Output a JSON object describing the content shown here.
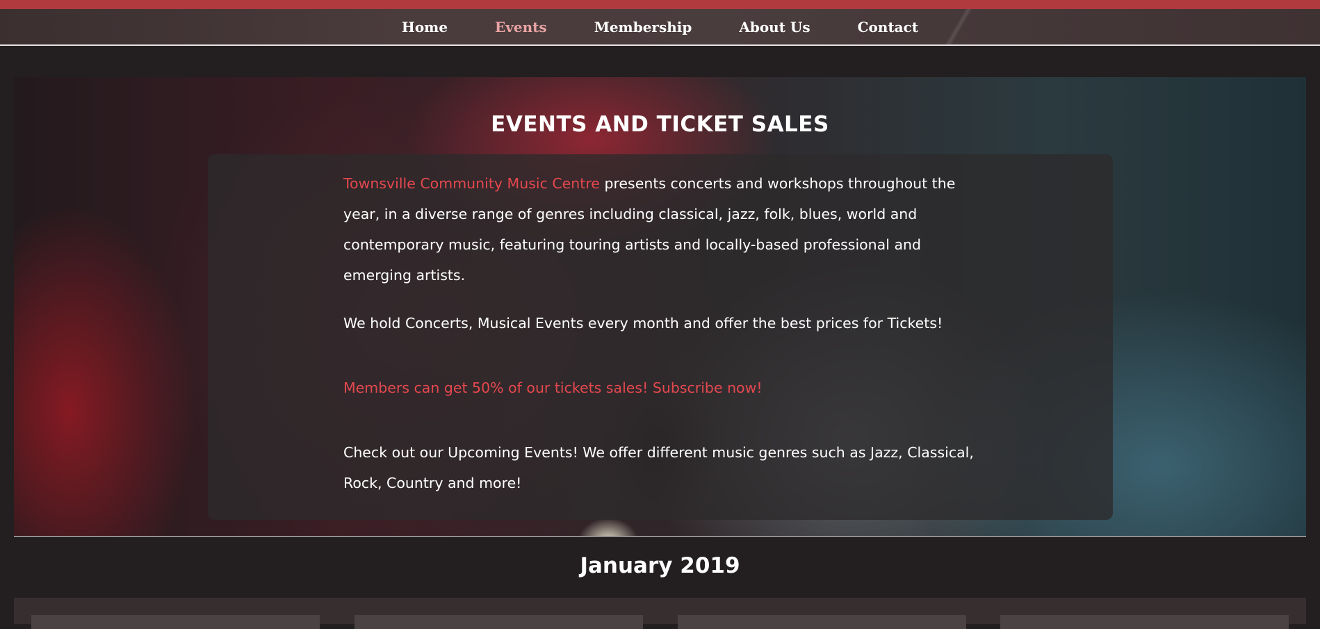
{
  "nav": {
    "items": [
      {
        "label": "Home",
        "active": false
      },
      {
        "label": "Events",
        "active": true
      },
      {
        "label": "Membership",
        "active": false
      },
      {
        "label": "About Us",
        "active": false
      },
      {
        "label": "Contact",
        "active": false
      }
    ]
  },
  "hero": {
    "title": "EVENTS AND TICKET SALES",
    "intro_highlight": "Townsville Community Music Centre",
    "intro_rest": " presents concerts and workshops throughout the year, in a diverse range of genres including classical, jazz, folk, blues, world and contemporary music, featuring touring artists and locally-based professional and emerging artists.",
    "paragraph_hold": "We hold Concerts, Musical Events every month and offer the best prices for Tickets!",
    "members_offer": "Members can get 50% of our tickets sales! Subscribe now!",
    "paragraph_check": "Check out our Upcoming Events! We offer different music genres such as Jazz, Classical, Rock, Country and more!"
  },
  "events": {
    "month_title": "January 2019"
  },
  "colors": {
    "accent": "#e5484f",
    "nav_active": "#e9a3a3",
    "top_bar": "#b03a3e",
    "background": "#231f20"
  }
}
